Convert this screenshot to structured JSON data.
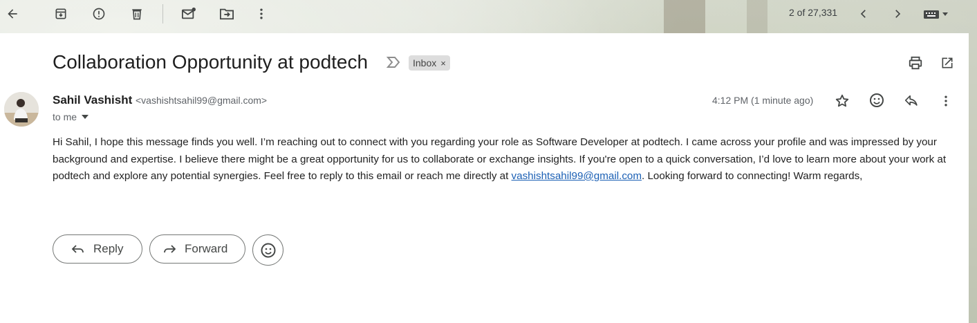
{
  "toolbar": {
    "counter": "2 of 27,331"
  },
  "email": {
    "subject": "Collaboration Opportunity at podtech",
    "label": "Inbox",
    "label_remove": "×",
    "sender_name": "Sahil Vashisht",
    "sender_email": "<vashishtsahil99@gmail.com>",
    "recipient": "to me",
    "time": "4:12 PM (1 minute ago)",
    "body_part1": "Hi Sahil, I hope this message finds you well. I’m reaching out to connect with you regarding your role as Software Developer at podtech. I came across your profile and was impressed by your background and expertise. I believe there might be a great opportunity for us to collaborate or exchange insights. If you're open to a quick conversation, I’d love to learn more about your work at podtech and explore any potential synergies. Feel free to reply to this email or reach me directly at ",
    "body_link": "vashishtsahil99@gmail.com",
    "body_part2": ". Looking forward to connecting! Warm regards,"
  },
  "actions": {
    "reply_label": "Reply",
    "forward_label": "Forward"
  },
  "colors": {
    "link": "#1a5fb4",
    "icon": "#444746"
  }
}
